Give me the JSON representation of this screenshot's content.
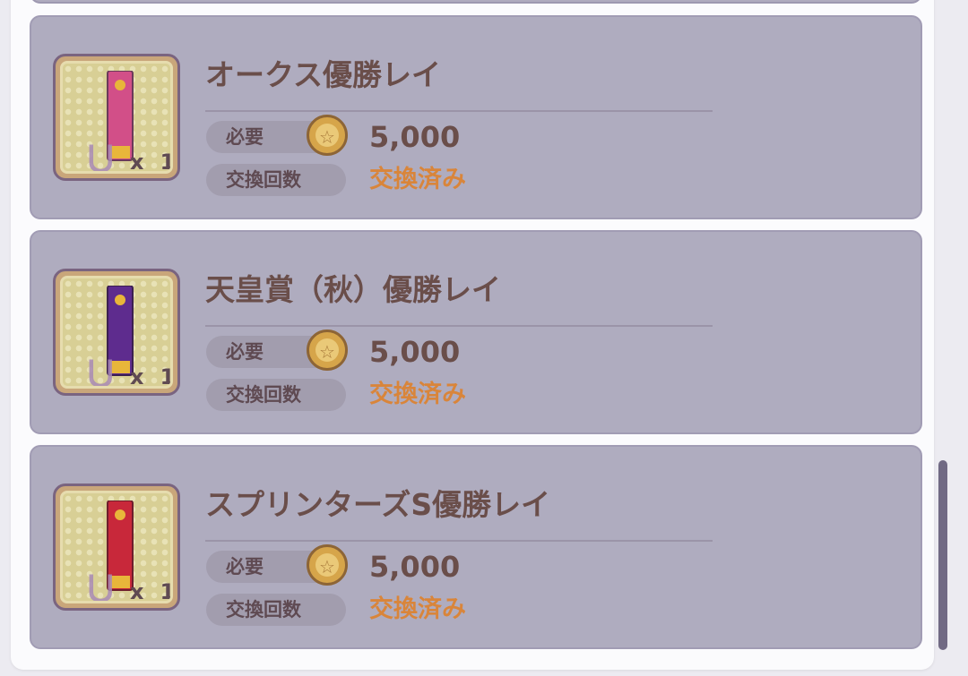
{
  "items": [
    {
      "title": "オークス優勝レイ",
      "quantity_prefix": "x",
      "quantity": "1",
      "required_label": "必要",
      "cost": "5,000",
      "count_label": "交換回数",
      "status": "交換済み",
      "banner_color": "#d24f88",
      "icon": "oaks-victory-lei-icon"
    },
    {
      "title": "天皇賞（秋）優勝レイ",
      "quantity_prefix": "x",
      "quantity": "1",
      "required_label": "必要",
      "cost": "5,000",
      "count_label": "交換回数",
      "status": "交換済み",
      "banner_color": "#5e2c8e",
      "icon": "tenno-sho-autumn-victory-lei-icon"
    },
    {
      "title": "スプリンターズS優勝レイ",
      "quantity_prefix": "x",
      "quantity": "1",
      "required_label": "必要",
      "cost": "5,000",
      "count_label": "交換回数",
      "status": "交換済み",
      "banner_color": "#c8283a",
      "icon": "sprinters-stakes-victory-lei-icon"
    }
  ],
  "colors": {
    "card_bg": "#afacbf",
    "title": "#6a4e4a",
    "status_exchanged": "#d9853a",
    "coin": "#d6a54a"
  },
  "currency_icon": "medal-coin-icon"
}
